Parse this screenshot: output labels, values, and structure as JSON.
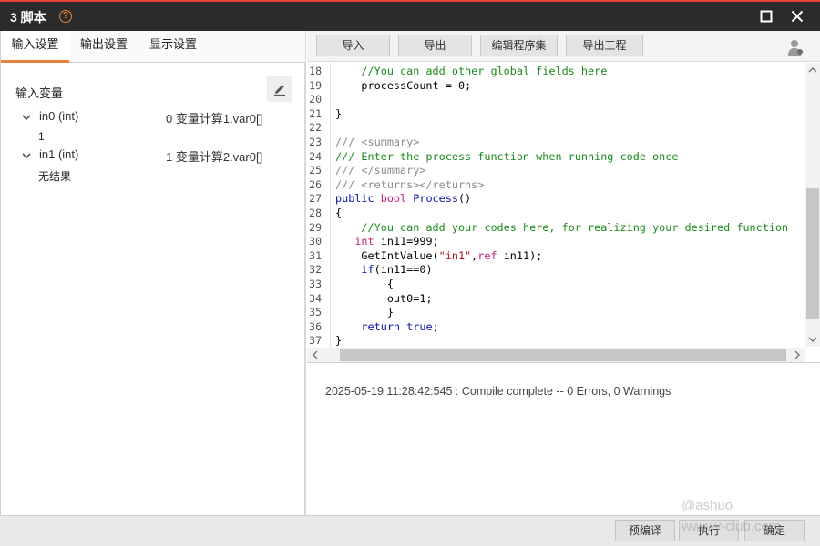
{
  "window": {
    "title": "3 脚本",
    "help_glyph": "?"
  },
  "left": {
    "tabs": [
      {
        "label": "输入设置",
        "active": true
      },
      {
        "label": "输出设置",
        "active": false
      },
      {
        "label": "显示设置",
        "active": false
      }
    ],
    "section_label": "输入变量",
    "variables": [
      {
        "name": "in0 (int)",
        "source": "0 变量计算1.var0[]",
        "value": "1"
      },
      {
        "name": "in1 (int)",
        "source": "1 变量计算2.var0[]",
        "value": "无结果"
      }
    ]
  },
  "toolbar": {
    "import_label": "导入",
    "export_label": "导出",
    "edit_set_label": "编辑程序集",
    "export_project_label": "导出工程"
  },
  "editor": {
    "lines": [
      {
        "n": "18",
        "tokens": [
          {
            "t": "    //You can add other global fields here",
            "c": "com"
          }
        ]
      },
      {
        "n": "19",
        "tokens": [
          {
            "t": "    processCount = 0;",
            "c": ""
          }
        ]
      },
      {
        "n": "20",
        "tokens": []
      },
      {
        "n": "21",
        "tokens": [
          {
            "t": "}",
            "c": ""
          }
        ]
      },
      {
        "n": "22",
        "tokens": []
      },
      {
        "n": "23",
        "tokens": [
          {
            "t": "/// <summary>",
            "c": "doc"
          }
        ]
      },
      {
        "n": "24",
        "tokens": [
          {
            "t": "/// Enter the process function when running code once",
            "c": "com"
          }
        ]
      },
      {
        "n": "25",
        "tokens": [
          {
            "t": "/// </summary>",
            "c": "doc"
          }
        ]
      },
      {
        "n": "26",
        "tokens": [
          {
            "t": "/// <returns></returns>",
            "c": "doc"
          }
        ]
      },
      {
        "n": "27",
        "tokens": [
          {
            "t": "public ",
            "c": "kw"
          },
          {
            "t": "bool ",
            "c": "kwr"
          },
          {
            "t": "Process",
            "c": "kw"
          },
          {
            "t": "()",
            "c": ""
          }
        ]
      },
      {
        "n": "28",
        "tokens": [
          {
            "t": "{",
            "c": ""
          }
        ]
      },
      {
        "n": "29",
        "tokens": [
          {
            "t": "    //You can add your codes here, for realizing your desired function",
            "c": "com"
          }
        ]
      },
      {
        "n": "30",
        "tokens": [
          {
            "t": "   ",
            "c": ""
          },
          {
            "t": "int ",
            "c": "kwr"
          },
          {
            "t": "in11=999;",
            "c": ""
          }
        ]
      },
      {
        "n": "31",
        "tokens": [
          {
            "t": "    GetIntValue(",
            "c": ""
          },
          {
            "t": "\"in1\"",
            "c": "str"
          },
          {
            "t": ",",
            "c": ""
          },
          {
            "t": "ref ",
            "c": "kwr"
          },
          {
            "t": "in11);",
            "c": ""
          }
        ]
      },
      {
        "n": "32",
        "tokens": [
          {
            "t": "    ",
            "c": ""
          },
          {
            "t": "if",
            "c": "kw"
          },
          {
            "t": "(in11==0)",
            "c": ""
          }
        ]
      },
      {
        "n": "33",
        "tokens": [
          {
            "t": "        {",
            "c": ""
          }
        ]
      },
      {
        "n": "34",
        "tokens": [
          {
            "t": "        out0=1;",
            "c": ""
          }
        ]
      },
      {
        "n": "35",
        "tokens": [
          {
            "t": "        }",
            "c": ""
          }
        ]
      },
      {
        "n": "36",
        "tokens": [
          {
            "t": "    ",
            "c": ""
          },
          {
            "t": "return ",
            "c": "kw"
          },
          {
            "t": "true",
            "c": "kw"
          },
          {
            "t": ";",
            "c": ""
          }
        ]
      },
      {
        "n": "37",
        "tokens": [
          {
            "t": "}",
            "c": ""
          }
        ]
      }
    ]
  },
  "log": {
    "message": "2025-05-19 11:28:42:545 : Compile complete -- 0 Errors, 0 Warnings"
  },
  "footer": {
    "precompile_label": "预编译",
    "run_label": "执行",
    "ok_label": "确定"
  },
  "watermark": {
    "line1": "@ashuo",
    "line2": "www.v-club.com"
  },
  "colors": {
    "accent": "#e8833a",
    "titlebar": "#2b2b2b",
    "top_stripe": "#e8433a"
  },
  "icons": {
    "help": "help-circle-icon",
    "maximize": "maximize-icon",
    "close": "close-icon",
    "edit": "pencil-icon",
    "user": "user-settings-icon",
    "expand": "chevron-down-icon"
  }
}
